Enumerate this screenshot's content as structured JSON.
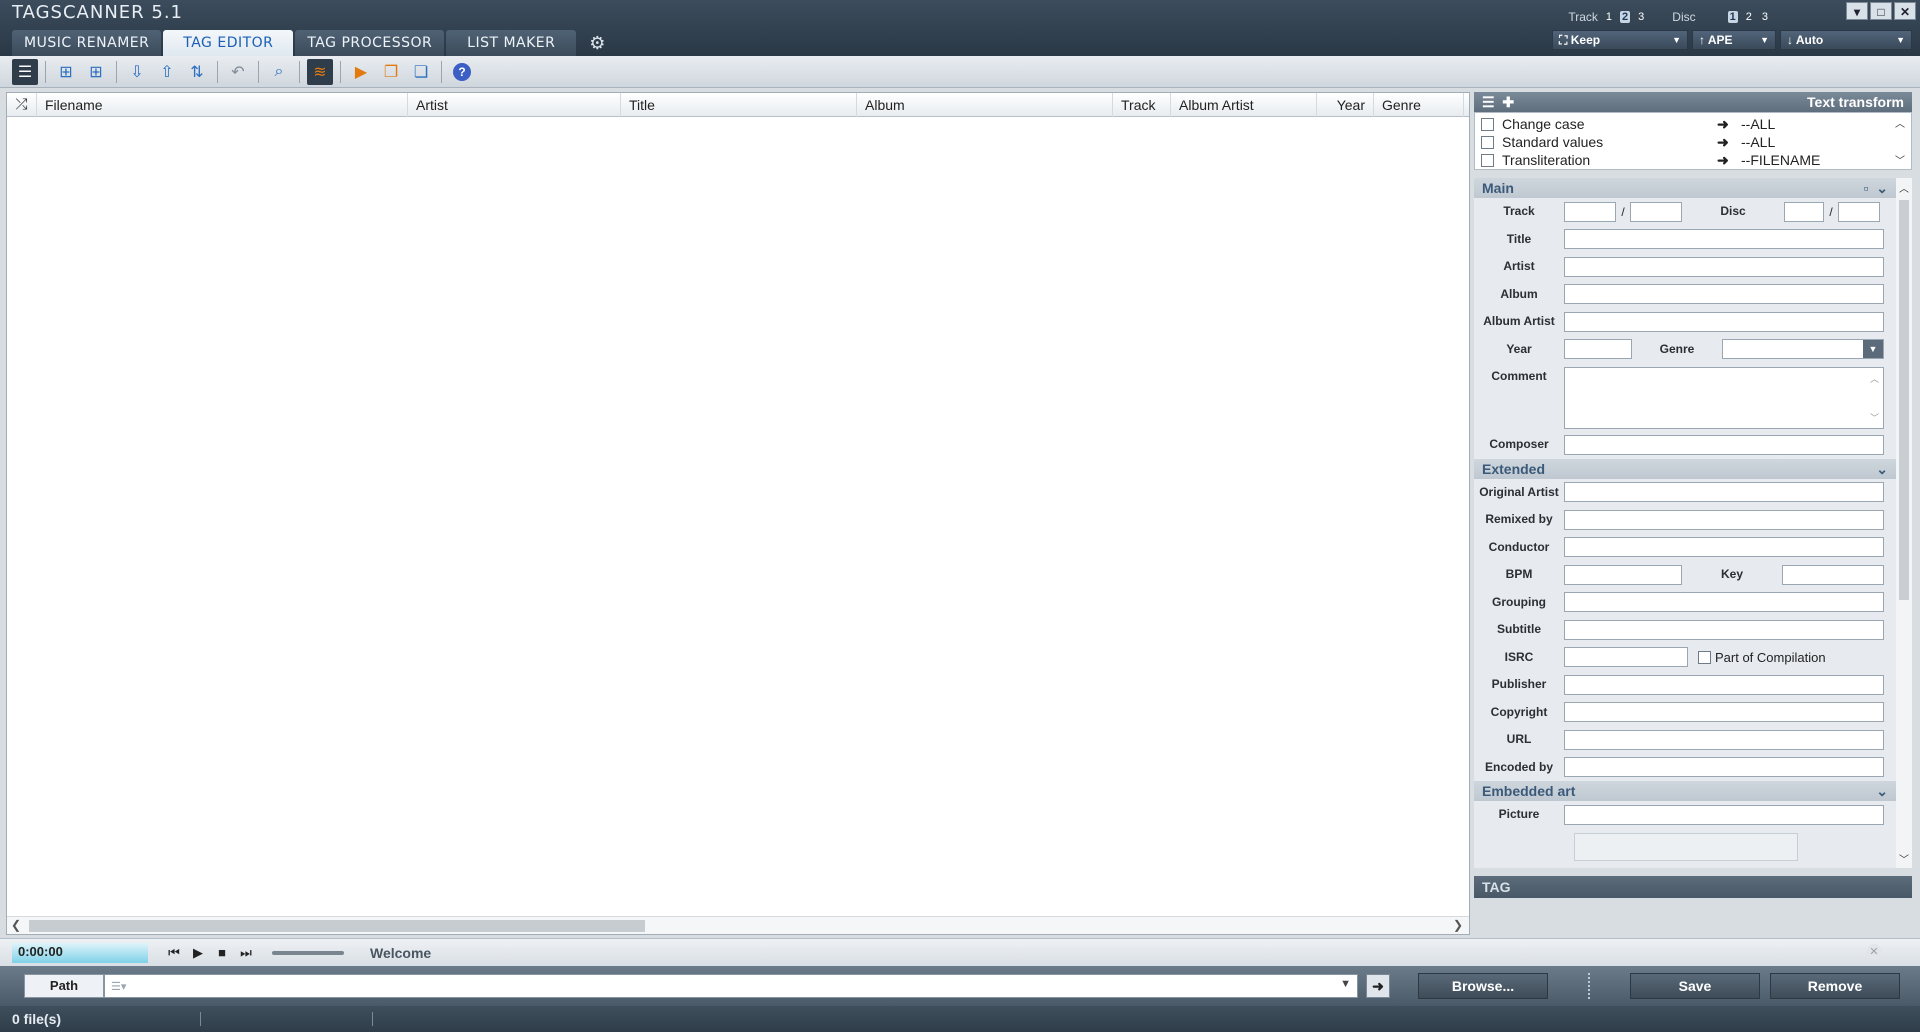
{
  "app": {
    "title": "TAGSCANNER 5.1"
  },
  "tabs": [
    {
      "label": "Music renamer"
    },
    {
      "label": "TAG EDITOR"
    },
    {
      "label": "TAG PROCESSOR"
    },
    {
      "label": "List maker"
    }
  ],
  "top_strip": {
    "track_label": "Track",
    "disc_label": "Disc",
    "track_nums": [
      "1",
      "2",
      "3"
    ],
    "disc_nums": [
      "1",
      "2",
      "3"
    ],
    "keep": "Keep",
    "ape": "APE",
    "auto": "Auto"
  },
  "columns": [
    "Filename",
    "Artist",
    "Title",
    "Album",
    "Track",
    "Album Artist",
    "Year",
    "Genre"
  ],
  "text_transform": {
    "title": "Text transform",
    "items": [
      {
        "name": "Change case",
        "target": "--ALL"
      },
      {
        "name": "Standard values",
        "target": "--ALL"
      },
      {
        "name": "Transliteration",
        "target": "--FILENAME"
      }
    ]
  },
  "sections": {
    "main": "Main",
    "extended": "Extended",
    "embedded_art": "Embedded art",
    "tag": "TAG"
  },
  "fields": {
    "track": "Track",
    "disc": "Disc",
    "title": "Title",
    "artist": "Artist",
    "album": "Album",
    "album_artist": "Album Artist",
    "year": "Year",
    "genre": "Genre",
    "comment": "Comment",
    "composer": "Composer",
    "original_artist": "Original Artist",
    "remixed_by": "Remixed by",
    "conductor": "Conductor",
    "bpm": "BPM",
    "key": "Key",
    "grouping": "Grouping",
    "subtitle": "Subtitle",
    "isrc": "ISRC",
    "part_of_compilation": "Part of Compilation",
    "publisher": "Publisher",
    "copyright": "Copyright",
    "url": "URL",
    "encoded_by": "Encoded by",
    "picture": "Picture",
    "slash": "/"
  },
  "player": {
    "time": "0:00:00",
    "status": "Welcome"
  },
  "pathbar": {
    "path_label": "Path",
    "browse": "Browse...",
    "save": "Save",
    "remove": "Remove"
  },
  "status": {
    "files": "0 file(s)"
  }
}
